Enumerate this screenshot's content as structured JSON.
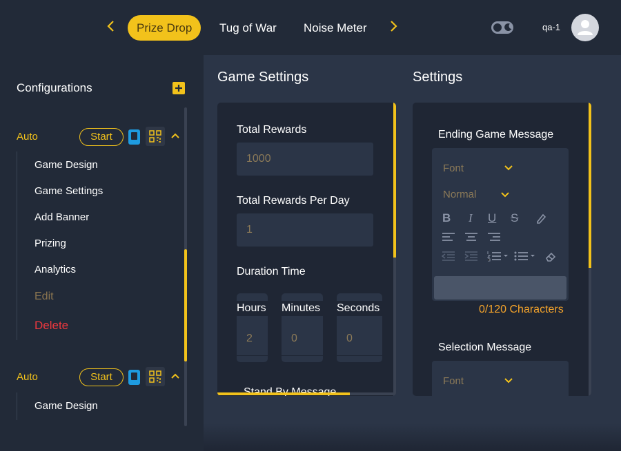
{
  "topbar": {
    "tabs": [
      {
        "label": "Prize Drop",
        "active": true
      },
      {
        "label": "Tug of War",
        "active": false
      },
      {
        "label": "Noise Meter",
        "active": false
      }
    ],
    "prev_icon": "chevron-left-icon",
    "next_icon": "chevron-right-icon",
    "theme_toggle_icon": "moon-icon",
    "username": "qa-1",
    "avatar_icon": "user-icon"
  },
  "sidebar": {
    "title": "Configurations",
    "add_icon": "plus-icon",
    "configs": [
      {
        "label": "Auto",
        "start_label": "Start",
        "expanded": true,
        "items": [
          "Game Design",
          "Game Settings",
          "Add Banner",
          "Prizing",
          "Analytics"
        ],
        "edit_label": "Edit",
        "delete_label": "Delete"
      },
      {
        "label": "Auto",
        "start_label": "Start",
        "expanded": true,
        "items": [
          "Game Design"
        ]
      }
    ]
  },
  "game_settings": {
    "title": "Game Settings",
    "total_rewards_label": "Total Rewards",
    "total_rewards_value": "1000",
    "per_day_label": "Total Rewards Per Day",
    "per_day_value": "1",
    "duration_label": "Duration Time",
    "hours_label": "Hours",
    "hours_value": "2",
    "minutes_label": "Minutes",
    "minutes_value": "0",
    "seconds_label": "Seconds",
    "seconds_value": "0",
    "standby_label": "Stand By Message"
  },
  "settings": {
    "title": "Settings",
    "ending_label": "Ending Game Message",
    "font_label": "Font",
    "size_label": "Normal",
    "char_count": "0/120 Characters",
    "selection_label": "Selection Message",
    "font_label_2": "Font"
  },
  "colors": {
    "accent": "#f2c21b",
    "delete": "#f0383e",
    "char_count": "#f2a22b",
    "phone_icon": "#1e9be0"
  }
}
